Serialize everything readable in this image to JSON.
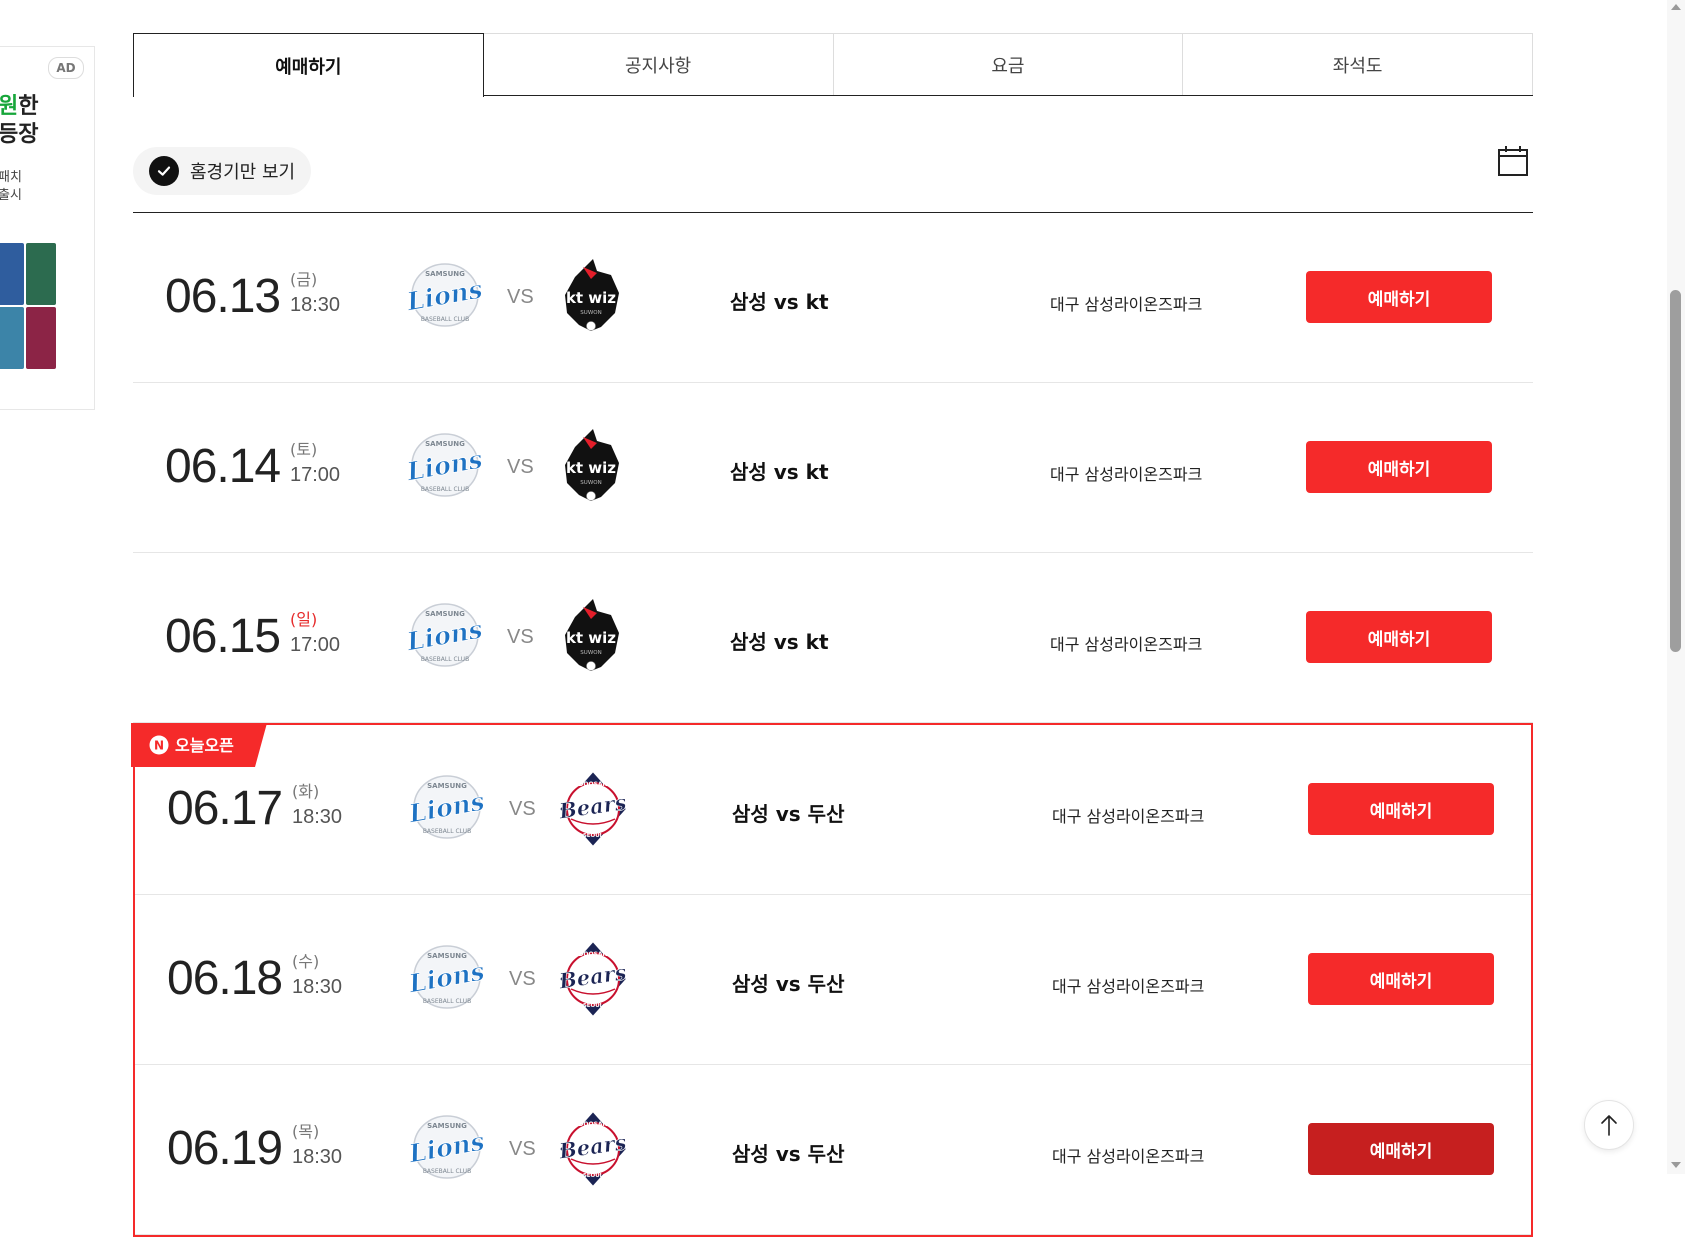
{
  "ad": {
    "badge": "AD",
    "headline_green": "원",
    "headline_rest": "한",
    "headline_line2": "등장",
    "sub_line1": "패치",
    "sub_line2": "출시"
  },
  "tabs": [
    {
      "label": "예매하기",
      "active": true
    },
    {
      "label": "공지사항",
      "active": false
    },
    {
      "label": "요금",
      "active": false
    },
    {
      "label": "좌석도",
      "active": false
    }
  ],
  "filter": {
    "label": "홈경기만 보기",
    "checked": true
  },
  "open_badge": {
    "label": "오늘오픈",
    "icon_letter": "N"
  },
  "games": [
    {
      "date": "06.13",
      "dow": "(금)",
      "sunday": false,
      "time": "18:30",
      "home_logo": "lions-logo",
      "away_logo": "ktwiz-logo",
      "vs": "VS",
      "matchup": "삼성 vs kt",
      "stadium": "대구 삼성라이온즈파크",
      "button": "예매하기",
      "today_open": false
    },
    {
      "date": "06.14",
      "dow": "(토)",
      "sunday": false,
      "time": "17:00",
      "home_logo": "lions-logo",
      "away_logo": "ktwiz-logo",
      "vs": "VS",
      "matchup": "삼성 vs kt",
      "stadium": "대구 삼성라이온즈파크",
      "button": "예매하기",
      "today_open": false
    },
    {
      "date": "06.15",
      "dow": "(일)",
      "sunday": true,
      "time": "17:00",
      "home_logo": "lions-logo",
      "away_logo": "ktwiz-logo",
      "vs": "VS",
      "matchup": "삼성 vs kt",
      "stadium": "대구 삼성라이온즈파크",
      "button": "예매하기",
      "today_open": false
    },
    {
      "date": "06.17",
      "dow": "(화)",
      "sunday": false,
      "time": "18:30",
      "home_logo": "lions-logo",
      "away_logo": "bears-logo",
      "vs": "VS",
      "matchup": "삼성 vs 두산",
      "stadium": "대구 삼성라이온즈파크",
      "button": "예매하기",
      "today_open": true
    },
    {
      "date": "06.18",
      "dow": "(수)",
      "sunday": false,
      "time": "18:30",
      "home_logo": "lions-logo",
      "away_logo": "bears-logo",
      "vs": "VS",
      "matchup": "삼성 vs 두산",
      "stadium": "대구 삼성라이온즈파크",
      "button": "예매하기",
      "today_open": true
    },
    {
      "date": "06.19",
      "dow": "(목)",
      "sunday": false,
      "time": "18:30",
      "home_logo": "lions-logo",
      "away_logo": "bears-logo",
      "vs": "VS",
      "matchup": "삼성 vs 두산",
      "stadium": "대구 삼성라이온즈파크",
      "button": "예매하기",
      "today_open": true
    }
  ],
  "logos": {
    "lions": {
      "word": "Lions",
      "top": "SAMSUNG",
      "bottom": "BASEBALL CLUB"
    },
    "ktwiz": {
      "word": "kt wiz",
      "bottom": "SUWON"
    },
    "bears": {
      "word": "Bears",
      "top": "DOOSAN",
      "bottom": "SEOUL"
    }
  },
  "colors": {
    "accent_red": "#f52a2a",
    "accent_red_pressed": "#c61f1f",
    "sunday_red": "#e62b2b",
    "lions_blue": "#1e72c3",
    "bears_navy": "#1b2454"
  }
}
